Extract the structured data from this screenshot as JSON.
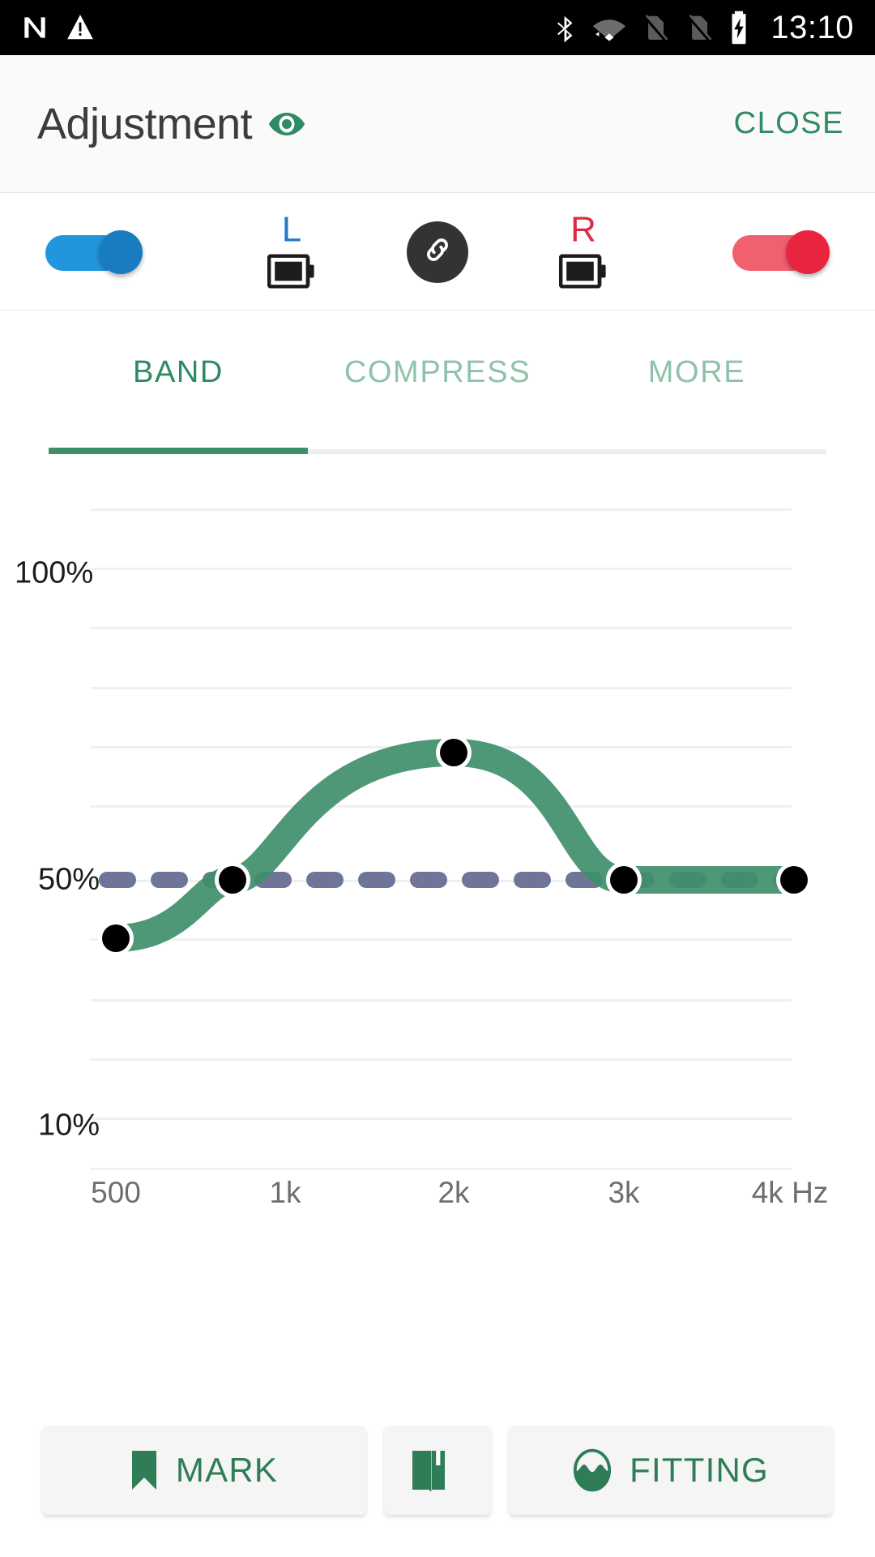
{
  "statusbar": {
    "time": "13:10",
    "icons": [
      "app-n-icon",
      "warning-triangle-icon",
      "bluetooth-icon",
      "wifi-icon",
      "no-sim-1-icon",
      "no-sim-2-icon",
      "battery-charging-icon"
    ]
  },
  "appbar": {
    "title": "Adjustment",
    "eye_icon": "eye-icon",
    "close_label": "CLOSE",
    "accent": "#2e8b63"
  },
  "device_row": {
    "left_toggle": {
      "name": "left-device-toggle",
      "state": "on",
      "color": "#2196dd",
      "knob_color": "#1a7cc0"
    },
    "right_toggle": {
      "name": "right-device-toggle",
      "state": "on",
      "color": "#f0606f",
      "knob_color": "#e8243f"
    },
    "left_side": {
      "label": "L",
      "color": "#2778c9",
      "battery_icon": "battery-icon"
    },
    "right_side": {
      "label": "R",
      "color": "#dd2b42",
      "battery_icon": "battery-icon"
    },
    "link_button": {
      "name": "link-button",
      "icon": "link-chain-icon",
      "background": "#333333"
    }
  },
  "tabs": [
    {
      "label": "BAND",
      "active": true
    },
    {
      "label": "COMPRESS",
      "active": false
    },
    {
      "label": "MORE",
      "active": false
    }
  ],
  "chart_data": {
    "type": "line",
    "title": "",
    "xlabel": "Hz",
    "ylabel": "%",
    "x_tick_labels": [
      "500",
      "1k",
      "2k",
      "3k",
      "4k Hz"
    ],
    "x_tick_values": [
      500,
      1000,
      2000,
      3000,
      4000
    ],
    "y_tick_labels": [
      "100%",
      "50%",
      "10%"
    ],
    "y_tick_values": [
      100,
      50,
      10
    ],
    "ylim": [
      0,
      122
    ],
    "grid": true,
    "grid_line_count": 12,
    "legend": "none",
    "series": [
      {
        "name": "band-gain-curve",
        "color": "#3f8f6b",
        "x": [
          500,
          1000,
          2000,
          3000,
          4000
        ],
        "values": [
          40,
          50,
          68,
          50,
          50
        ],
        "handles": [
          "handle-500",
          "handle-1k",
          "handle-2k",
          "handle-3k",
          "handle-4k"
        ],
        "handle_color": "#000000"
      }
    ],
    "reference_line": {
      "name": "target-reference-line",
      "value": 50,
      "style": "dashed",
      "color": "#6f7598"
    }
  },
  "bottom_buttons": [
    {
      "label": "MARK",
      "icon": "bookmark-icon",
      "name": "mark-button"
    },
    {
      "label": "",
      "icon": "book-icon",
      "name": "book-button"
    },
    {
      "label": "FITTING",
      "icon": "fitting-wave-icon",
      "name": "fitting-button"
    }
  ]
}
